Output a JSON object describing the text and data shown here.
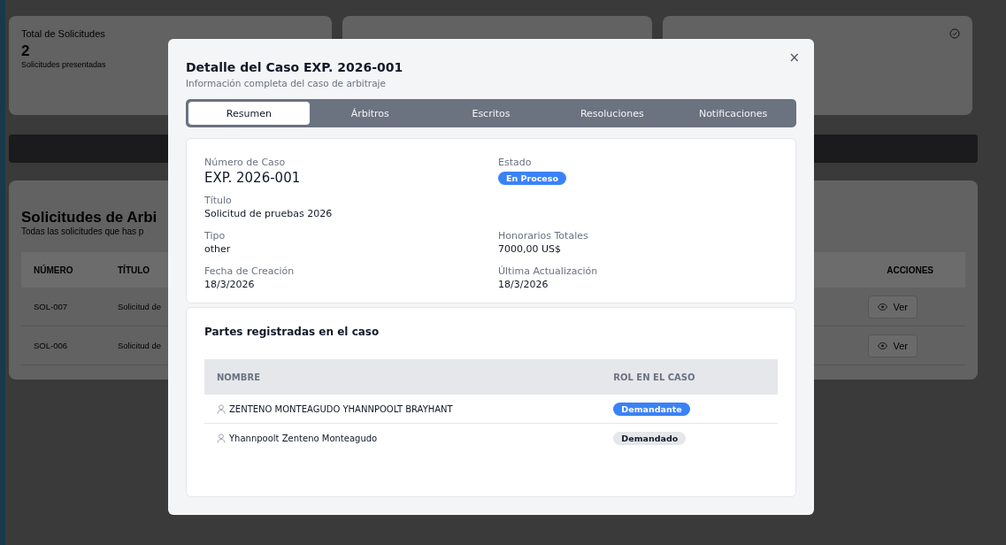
{
  "background": {
    "stat_cards": [
      {
        "title": "Total de Solicitudes",
        "value": "2",
        "caption": "Solicitudes presentadas",
        "icon": false
      },
      {
        "icon": false
      },
      {
        "icon": true
      }
    ],
    "section": {
      "title": "Solicitudes de Arbi",
      "subtitle": "Todas las solicitudes que has p"
    },
    "table": {
      "columns": [
        "NÚMERO",
        "TÍTULO",
        "ACCIONES"
      ],
      "rows": [
        {
          "number": "SOL-007",
          "title": "Solicitud de",
          "action": "Ver"
        },
        {
          "number": "SOL-006",
          "title": "Solicitud de",
          "action": "Ver"
        }
      ]
    }
  },
  "dialog": {
    "title": "Detalle del Caso EXP. 2026-001",
    "subtitle": "Información completa del caso de arbitraje",
    "close": "×",
    "tabs": [
      {
        "label": "Resumen",
        "selected": true
      },
      {
        "label": "Árbitros",
        "selected": false
      },
      {
        "label": "Escritos",
        "selected": false
      },
      {
        "label": "Resoluciones",
        "selected": false
      },
      {
        "label": "Notificaciones",
        "selected": false
      }
    ],
    "fields": [
      {
        "label": "Número de Caso",
        "value": "EXP. 2026-001",
        "kind": "large"
      },
      {
        "label": "Estado",
        "value": "En Proceso",
        "kind": "badge",
        "color": "#3b82f6"
      },
      {
        "label": "Título",
        "value": "Solicitud de pruebas 2026",
        "kind": "text"
      },
      {
        "kind": "empty"
      },
      {
        "label": "Tipo",
        "value": "other",
        "kind": "text"
      },
      {
        "label": "Honorarios Totales",
        "value": "7000,00 US$",
        "kind": "text"
      },
      {
        "label": "Fecha de Creación",
        "value": "18/3/2026",
        "kind": "text"
      },
      {
        "label": "Última Actualización",
        "value": "18/3/2026",
        "kind": "text"
      }
    ],
    "parties": {
      "title": "Partes registradas en el caso",
      "columns": [
        "NOMBRE",
        "ROL EN EL CASO"
      ],
      "rows": [
        {
          "name": "ZENTENO MONTEAGUDO YHANNPOOLT BRAYHANT",
          "role": "Demandante",
          "color": "#3b82f6"
        },
        {
          "name": "Yhannpoolt Zenteno Monteagudo",
          "role": "Demandado",
          "color": "#e5e7eb"
        }
      ]
    }
  }
}
